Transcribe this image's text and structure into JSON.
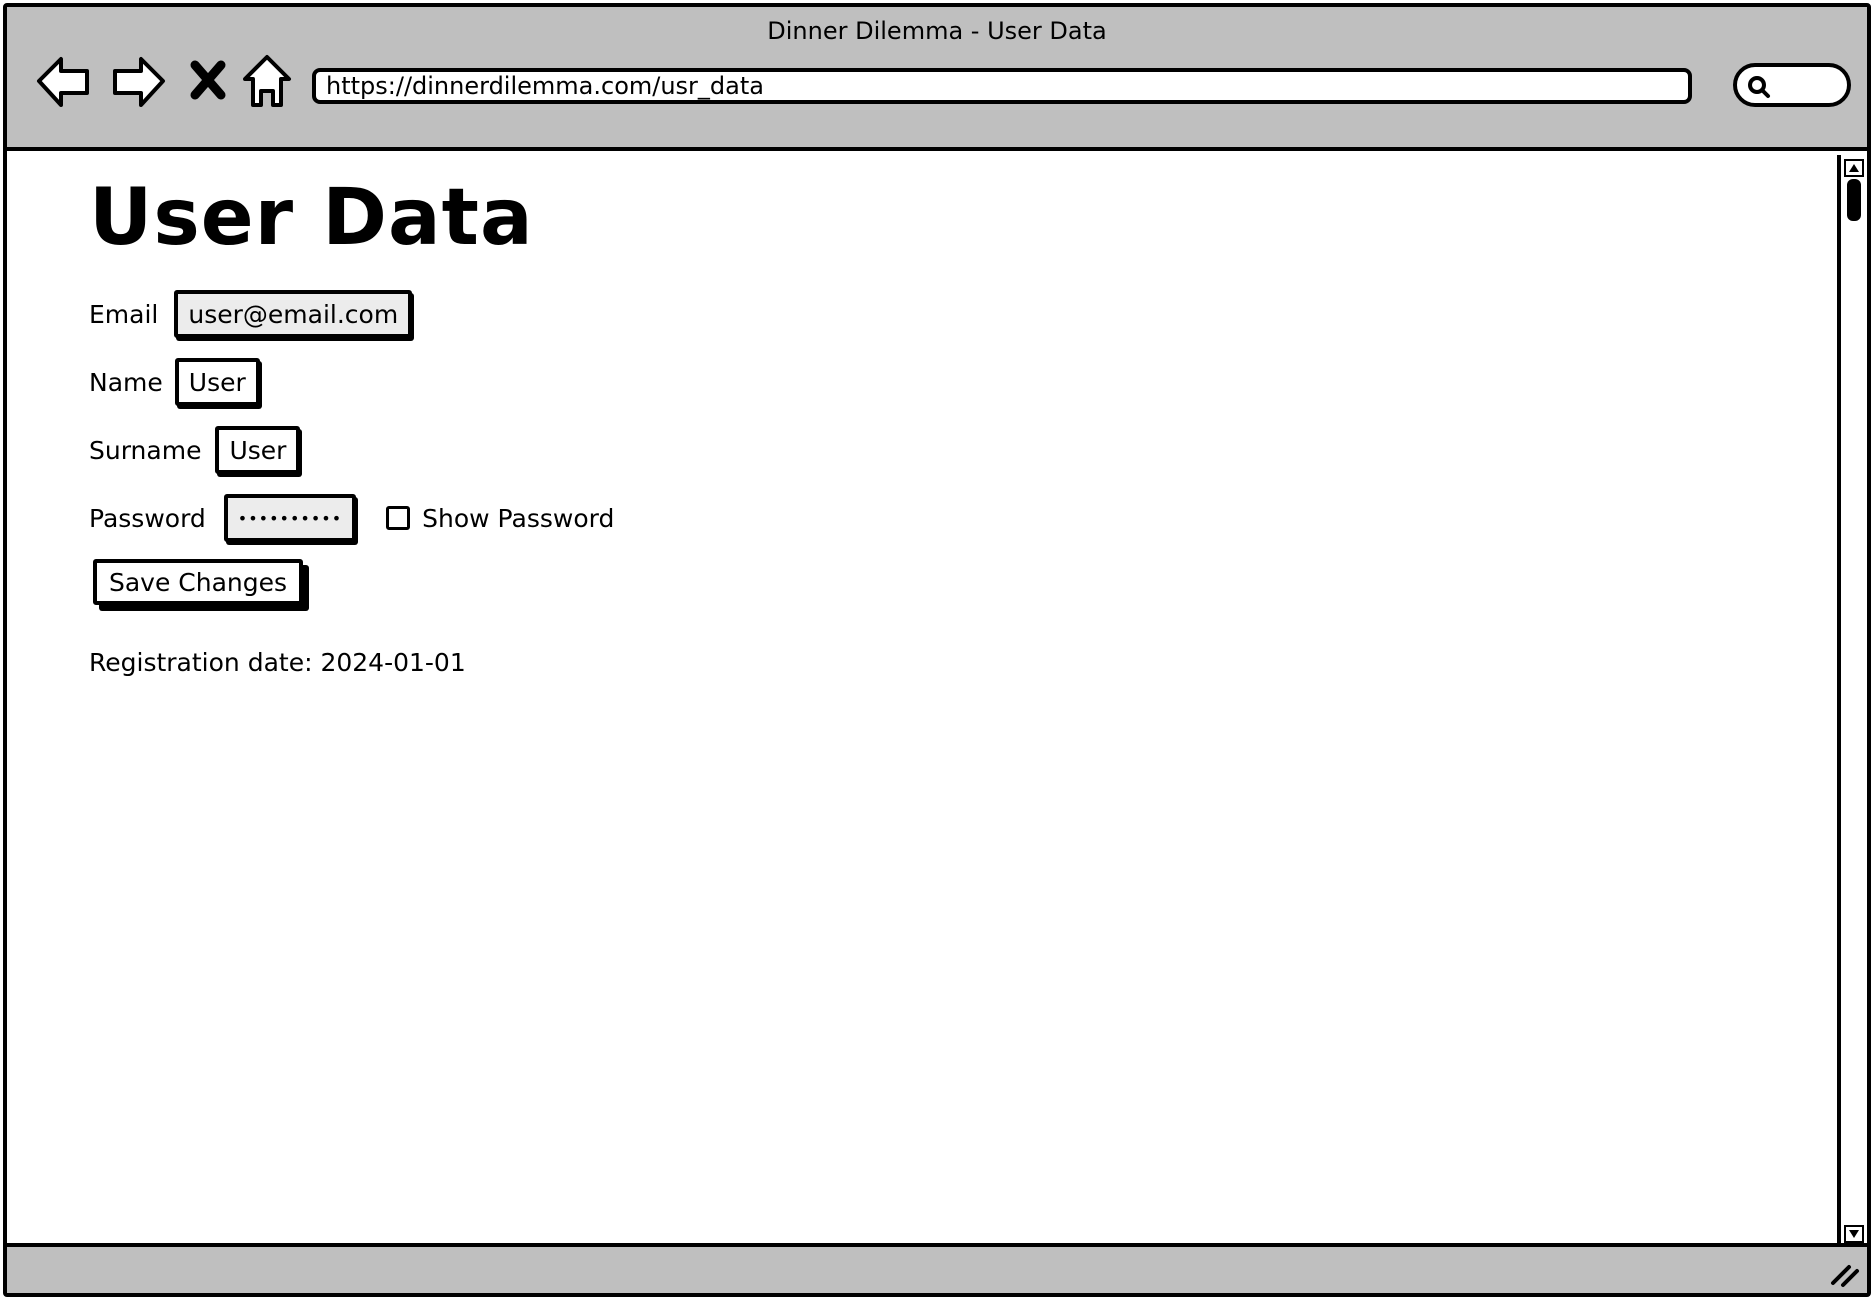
{
  "window": {
    "title": "Dinner Dilemma - User Data",
    "url": "https://dinnerdilemma.com/usr_data",
    "nav_icons": [
      "back-arrow-icon",
      "forward-arrow-icon",
      "stop-icon",
      "home-icon"
    ],
    "search_icon": "search-icon"
  },
  "page": {
    "title": "User Data",
    "fields": {
      "email": {
        "label": "Email",
        "value": "user@email.com"
      },
      "name": {
        "label": "Name",
        "value": "User"
      },
      "surname": {
        "label": "Surname",
        "value": "User"
      },
      "password": {
        "label": "Password",
        "value": "••••••••••"
      }
    },
    "show_password_label": "Show Password",
    "save_button": "Save Changes",
    "registration": "Registration date: 2024-01-01"
  },
  "colors": {
    "chrome": "#bfbfbf",
    "field_gray": "#ececec",
    "outline": "#000000"
  }
}
